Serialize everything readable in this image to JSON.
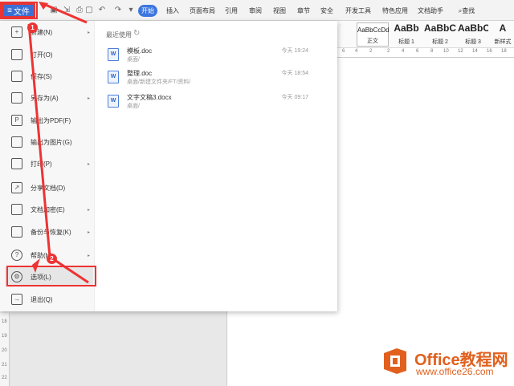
{
  "toolbar": {
    "file_label": "文件",
    "file_icon": "menu-icon",
    "tabs": [
      {
        "label": "开始",
        "active": true
      },
      {
        "label": "插入"
      },
      {
        "label": "页面布局"
      },
      {
        "label": "引用"
      },
      {
        "label": "审阅"
      },
      {
        "label": "视图"
      },
      {
        "label": "章节"
      },
      {
        "label": "安全"
      },
      {
        "label": "开发工具"
      },
      {
        "label": "特色应用"
      },
      {
        "label": "文档助手"
      },
      {
        "label": "查找"
      }
    ]
  },
  "styles": [
    {
      "sample": "AaBbCcDd",
      "name": "正文"
    },
    {
      "sample": "AaBb",
      "name": "标题 1"
    },
    {
      "sample": "AaBbC",
      "name": "标题 2"
    },
    {
      "sample": "AaBbC",
      "name": "标题 3"
    },
    {
      "sample": "A",
      "name": "新样式"
    }
  ],
  "menu": {
    "items": [
      {
        "label": "新建(N)",
        "icon": "new-doc-icon",
        "has_submenu": true
      },
      {
        "label": "打开(O)",
        "icon": "folder-icon",
        "has_submenu": false
      },
      {
        "label": "保存(S)",
        "icon": "save-icon",
        "has_submenu": false
      },
      {
        "label": "另存为(A)",
        "icon": "save-as-icon",
        "has_submenu": true
      },
      {
        "label": "输出为PDF(F)",
        "icon": "pdf-icon",
        "has_submenu": false
      },
      {
        "label": "输出为图片(G)",
        "icon": "image-icon",
        "has_submenu": false
      },
      {
        "label": "打印(P)",
        "icon": "print-icon",
        "has_submenu": true
      },
      {
        "label": "分享文档(D)",
        "icon": "share-icon",
        "has_submenu": false
      },
      {
        "label": "文档加密(E)",
        "icon": "lock-icon",
        "has_submenu": true
      },
      {
        "label": "备份与恢复(K)",
        "icon": "backup-icon",
        "has_submenu": true
      },
      {
        "label": "帮助(H)",
        "icon": "help-icon",
        "has_submenu": true
      },
      {
        "label": "选项(L)",
        "icon": "gear-icon",
        "has_submenu": false,
        "highlighted": true
      },
      {
        "label": "退出(Q)",
        "icon": "exit-icon",
        "has_submenu": false
      }
    ],
    "recent_title": "最近使用",
    "recent": [
      {
        "name": "模板.doc",
        "path": "桌面/",
        "time": "今天 19:24"
      },
      {
        "name": "整理.doc",
        "path": "桌面/新建文件夹/FT/资料/",
        "time": "今天 18:54"
      },
      {
        "name": "文字文稿3.docx",
        "path": "桌面/",
        "time": "今天 09:17"
      }
    ]
  },
  "annotations": {
    "badge1": "1",
    "badge2": "2",
    "color": "#e33333"
  },
  "watermark": {
    "line1": "Office教程网",
    "line2": "www.office26.com"
  }
}
